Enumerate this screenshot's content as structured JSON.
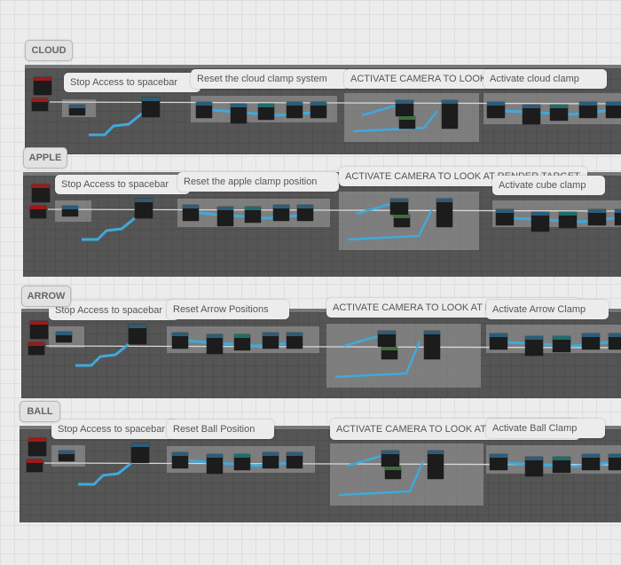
{
  "sections": [
    {
      "tag": "CLOUD",
      "stop": "Stop Access to spacebar",
      "reset": "Reset the cloud clamp system",
      "camera": "ACTIVATE CAMERA TO LOOK AT RENDER TARGET",
      "clamp": "Activate cloud clamp"
    },
    {
      "tag": "APPLE",
      "stop": "Stop Access to spacebar",
      "reset": "Reset the apple clamp position",
      "camera": "ACTIVATE CAMERA TO LOOK AT RENDER TARGET",
      "clamp": "Activate cube clamp"
    },
    {
      "tag": "ARROW",
      "stop": "Stop Access to spacebar",
      "reset": "Reset Arrow Positions",
      "camera": "ACTIVATE CAMERA TO LOOK AT RENDER TARGET",
      "clamp": "Activate Arrow Clamp"
    },
    {
      "tag": "BALL",
      "stop": "Stop Access to spacebar",
      "reset": "Reset Ball Position",
      "camera": "ACTIVATE CAMERA TO LOOK AT RENDER TARGET",
      "clamp": "Activate Ball Clamp"
    }
  ],
  "colors": {
    "wire": "#3fa9dc",
    "exec_wire": "#d8d8d8",
    "panel": "#555555",
    "event_node": "#a01818"
  }
}
